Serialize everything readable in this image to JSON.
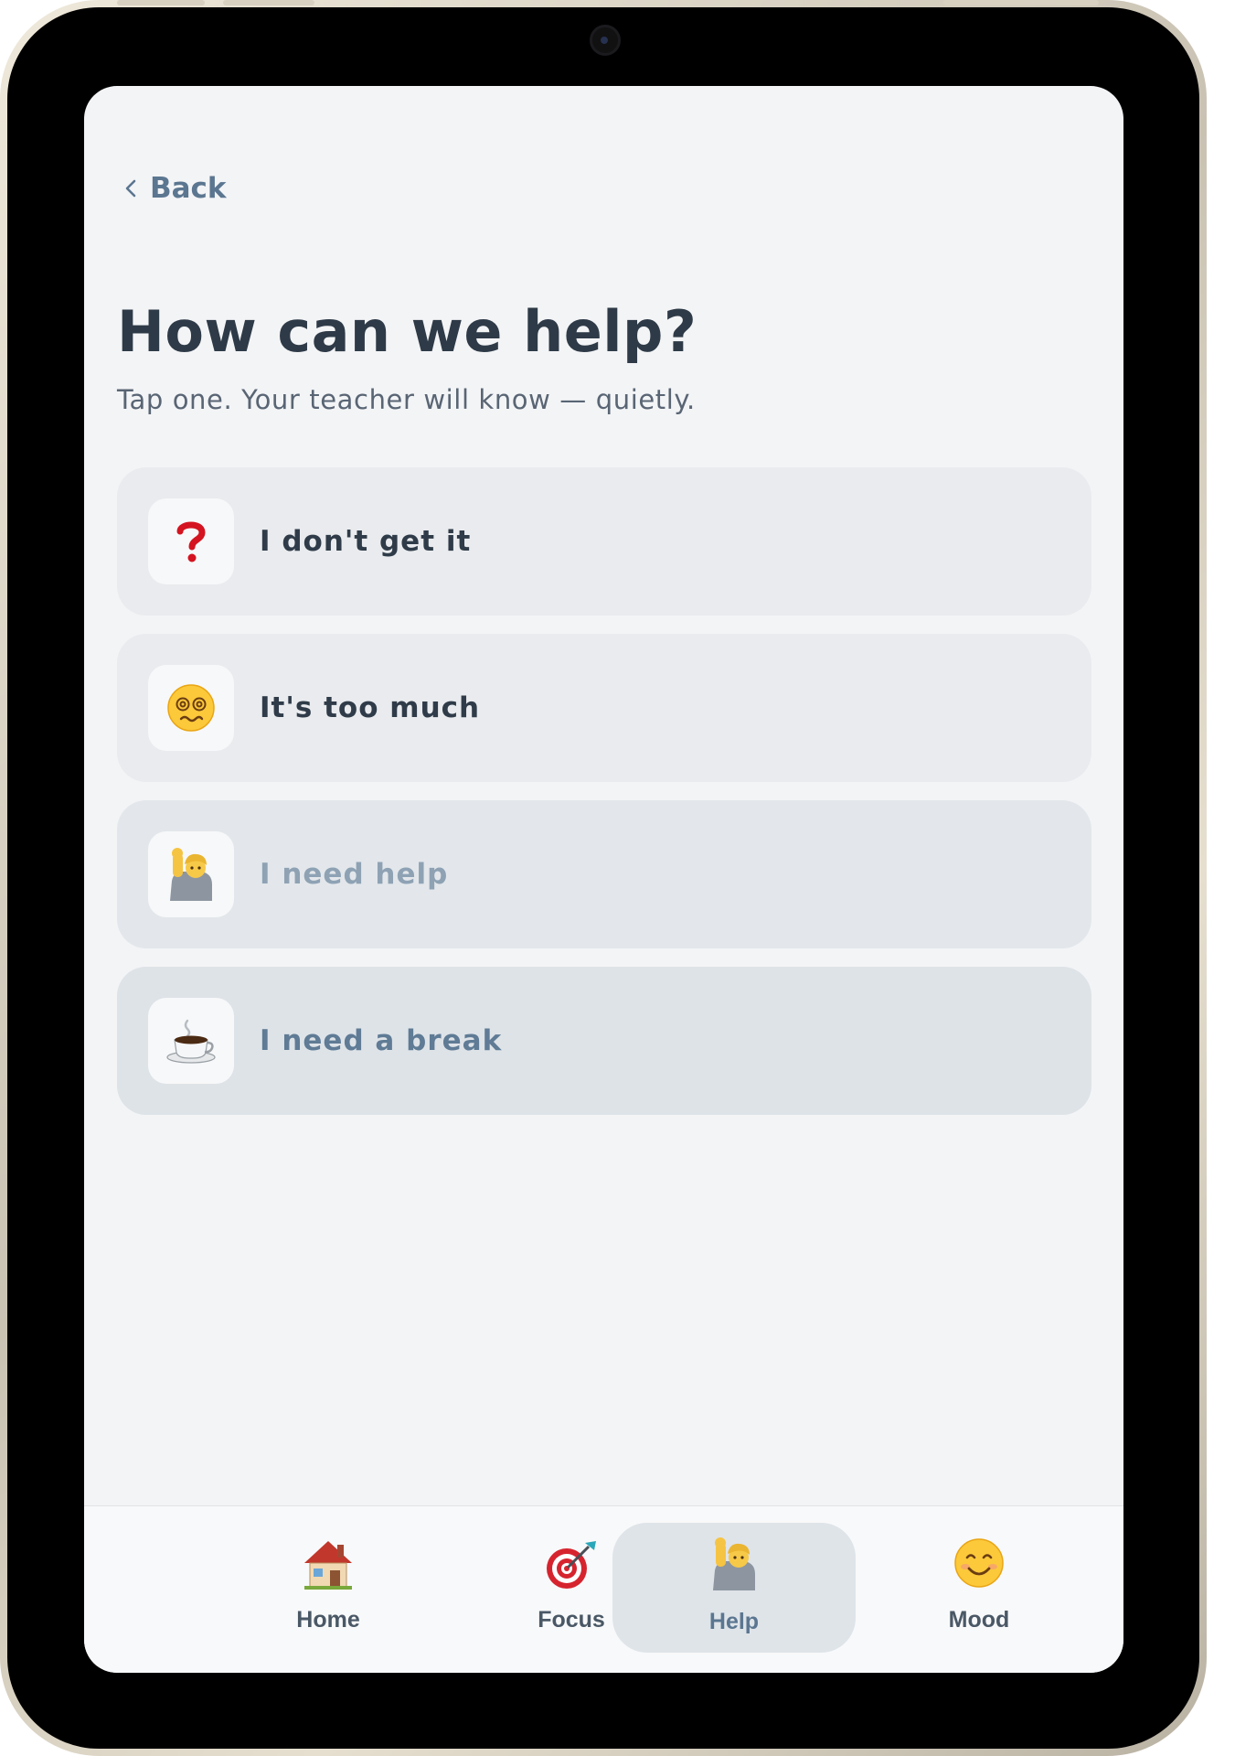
{
  "nav": {
    "back_label": "Back"
  },
  "header": {
    "title": "How can we help?",
    "subtitle": "Tap one. Your teacher will know — quietly."
  },
  "options": [
    {
      "label": "I don't get it",
      "icon": "question-mark-icon"
    },
    {
      "label": "It's too much",
      "icon": "dizzy-face-icon"
    },
    {
      "label": "I need help",
      "icon": "raising-hand-icon"
    },
    {
      "label": "I need a break",
      "icon": "coffee-icon"
    }
  ],
  "tabs": [
    {
      "label": "Home",
      "icon": "house-icon",
      "active": false
    },
    {
      "label": "Focus",
      "icon": "target-icon",
      "active": false
    },
    {
      "label": "Help",
      "icon": "raising-hand-icon",
      "active": true
    },
    {
      "label": "Mood",
      "icon": "smiley-icon",
      "active": false
    }
  ],
  "colors": {
    "accent": "#5b7690",
    "screen_background": "#f3f4f6",
    "title": "#2e3a47",
    "active_tab_background": "#dfe4e9"
  }
}
